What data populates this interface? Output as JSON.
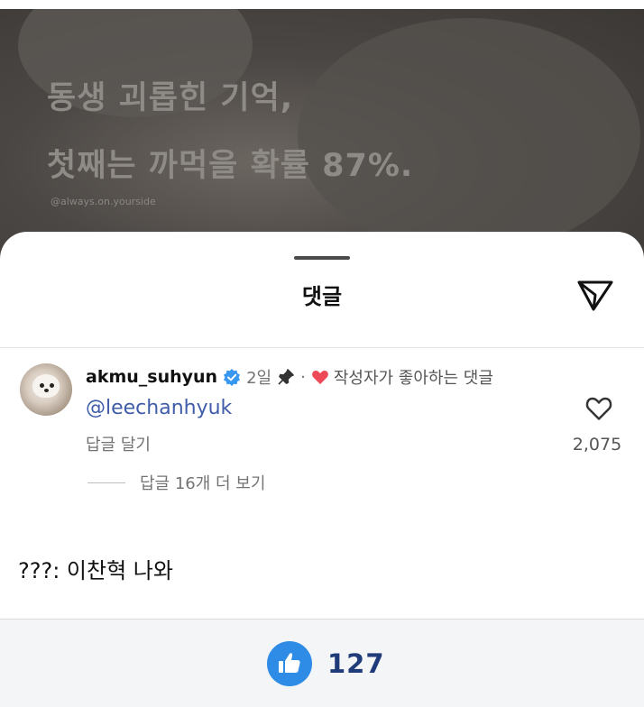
{
  "hero": {
    "line1": "동생 괴롭힌 기억,",
    "line2": "첫째는 까먹을 확률 87%.",
    "credit": "@always.on.yourside"
  },
  "sheet": {
    "title": "댓글"
  },
  "comment": {
    "username": "akmu_suhyun",
    "age": "2일",
    "separator": "·",
    "author_liked": "작성자가 좋아하는 댓글",
    "text": "@leechanhyuk",
    "reply_label": "답글 달기",
    "view_replies": "답글 16개 더 보기",
    "like_count": "2,075"
  },
  "caption": "???: 이찬혁 나와",
  "footer": {
    "reaction_count": "127"
  },
  "colors": {
    "mention": "#3f5da8",
    "verified": "#3897f0",
    "heart": "#ed4956",
    "thumb_button": "#2e8be6"
  },
  "icons": [
    "send-icon",
    "verified-icon",
    "pin-icon",
    "heart-icon",
    "thumbs-up-icon"
  ]
}
